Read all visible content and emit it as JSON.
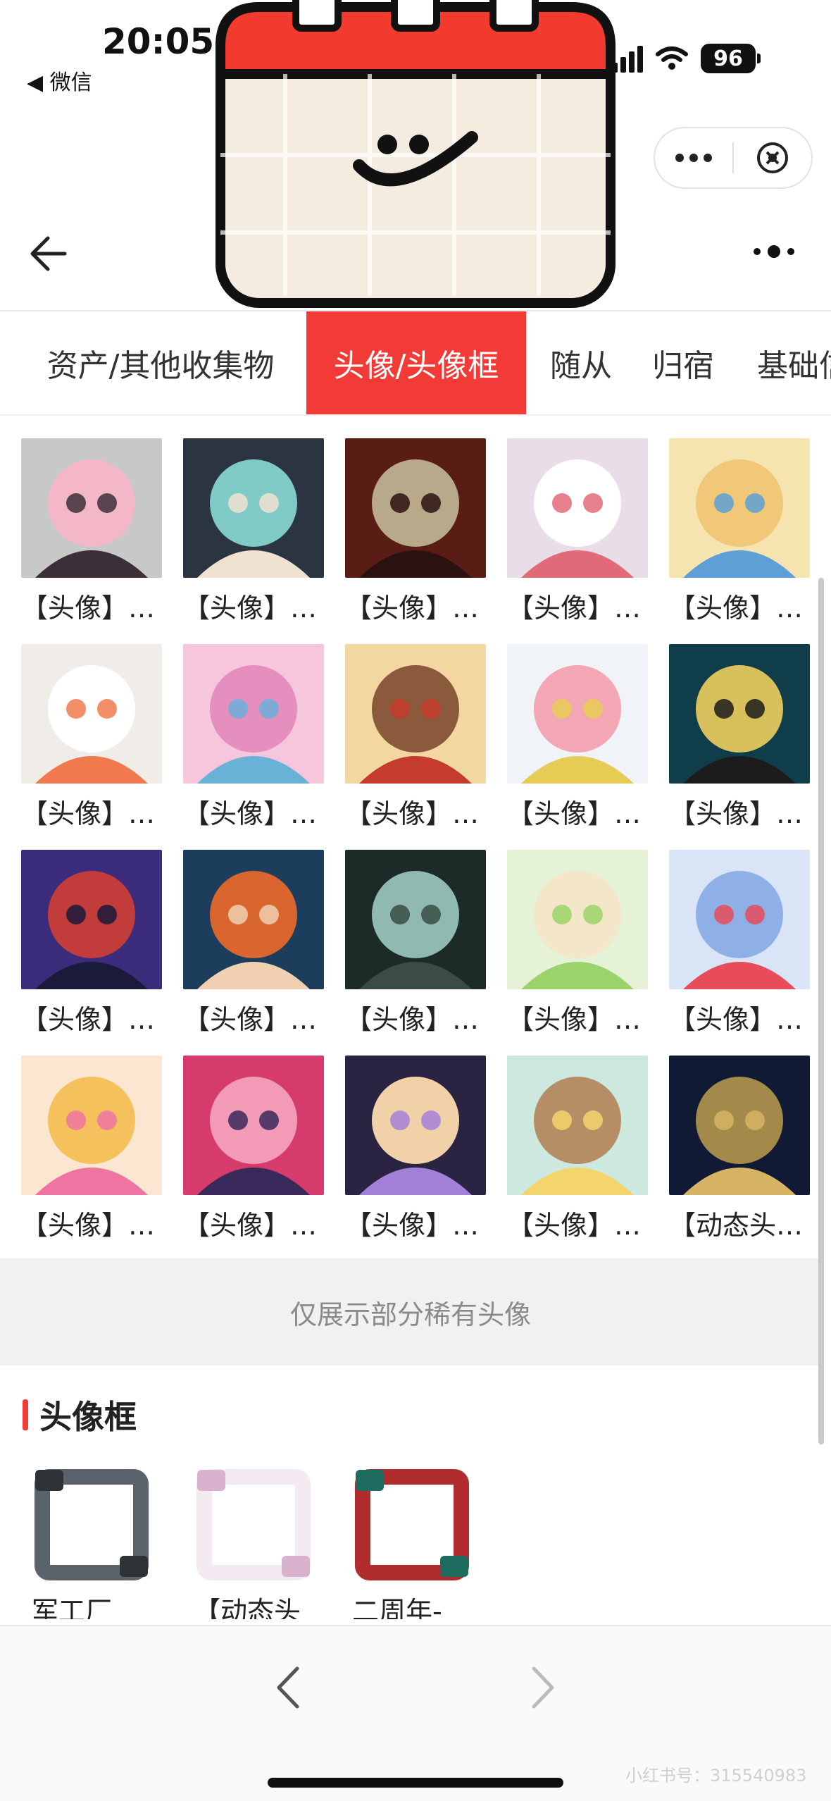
{
  "status_bar": {
    "time": "20:05",
    "back_label": "◀ 微信",
    "battery": "96"
  },
  "capsule": {
    "more_icon": "more-dots-icon",
    "close_icon": "close-circle-icon"
  },
  "tabs": [
    {
      "label": "资产/其他收集物",
      "active": false
    },
    {
      "label": "头像/头像框",
      "active": true
    },
    {
      "label": "随从",
      "active": false
    },
    {
      "label": "归宿",
      "active": false
    },
    {
      "label": "基础信",
      "active": false
    }
  ],
  "avatars": [
    {
      "caption": "【头像】…",
      "colors": [
        "#c8c8c8",
        "#f3b7c7",
        "#3d2f3a"
      ]
    },
    {
      "caption": "【头像】…",
      "colors": [
        "#2b3441",
        "#7fc9c7",
        "#f0e2d0"
      ]
    },
    {
      "caption": "【头像】…",
      "colors": [
        "#5a1d16",
        "#b8a98a",
        "#2b1210"
      ]
    },
    {
      "caption": "【头像】…",
      "colors": [
        "#e9dde7",
        "#ffffff",
        "#e06a78"
      ]
    },
    {
      "caption": "【头像】…",
      "colors": [
        "#f6e4b0",
        "#f0c878",
        "#5ea0d6"
      ]
    },
    {
      "caption": "【头像】…",
      "colors": [
        "#f0ede8",
        "#ffffff",
        "#f07a4e"
      ]
    },
    {
      "caption": "【头像】…",
      "colors": [
        "#f6c6dd",
        "#e58fbf",
        "#6ab1d8"
      ]
    },
    {
      "caption": "【头像】…",
      "colors": [
        "#f3d7a0",
        "#8b5a3c",
        "#c53c2c"
      ]
    },
    {
      "caption": "【头像】…",
      "colors": [
        "#f0f3f8",
        "#f3a6b3",
        "#e6cc55"
      ]
    },
    {
      "caption": "【头像】…",
      "colors": [
        "#0f3e4a",
        "#d8c05c",
        "#1c1c1c"
      ]
    },
    {
      "caption": "【头像】…",
      "colors": [
        "#3b2b7b",
        "#c23c3c",
        "#1a1a3a"
      ]
    },
    {
      "caption": "【头像】…",
      "colors": [
        "#1d3d5d",
        "#d8662e",
        "#f0d0b0"
      ]
    },
    {
      "caption": "【头像】…",
      "colors": [
        "#1c2a28",
        "#8fb9b1",
        "#3a4c44"
      ]
    },
    {
      "caption": "【头像】…",
      "colors": [
        "#e5f2d6",
        "#f3e6c9",
        "#9bd36a"
      ]
    },
    {
      "caption": "【头像】…",
      "colors": [
        "#d9e5f7",
        "#8fb0e6",
        "#e84c5a"
      ]
    },
    {
      "caption": "【头像】…",
      "colors": [
        "#fbe6d2",
        "#f4c15c",
        "#ef74a2"
      ]
    },
    {
      "caption": "【头像】…",
      "colors": [
        "#d53c6b",
        "#f39ab6",
        "#39295a"
      ]
    },
    {
      "caption": "【头像】…",
      "colors": [
        "#2a2342",
        "#f1d1a8",
        "#a481d8"
      ]
    },
    {
      "caption": "【头像】…",
      "colors": [
        "#cde8df",
        "#b58e66",
        "#f3d56c"
      ]
    },
    {
      "caption": "【动态头…",
      "colors": [
        "#101a35",
        "#a38a4a",
        "#d7b463"
      ]
    }
  ],
  "note": "仅展示部分稀有头像",
  "frames_section": {
    "title": "头像框",
    "items": [
      {
        "caption": "军工厂",
        "colors": [
          "#5a626b",
          "#2d3237"
        ]
      },
      {
        "caption": "【动态头",
        "colors": [
          "#f4eaf1",
          "#d9b3cd"
        ]
      },
      {
        "caption": "二周年-",
        "colors": [
          "#b12c2c",
          "#1e6b5f"
        ]
      }
    ]
  },
  "bottom_bar": {
    "prev_icon": "chevron-left-icon",
    "next_icon": "chevron-right-icon"
  },
  "watermark": "小红书号：315540983"
}
